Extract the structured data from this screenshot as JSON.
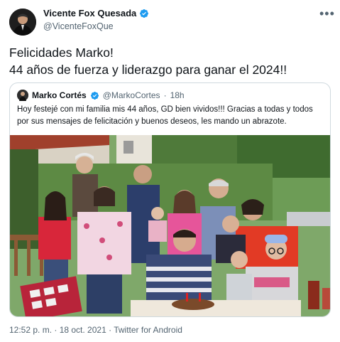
{
  "author": {
    "display_name": "Vicente Fox Quesada",
    "handle": "@VicenteFoxQue"
  },
  "tweet": {
    "line1": "Felicidades Marko!",
    "line2": "44 años de fuerza y liderazgo para ganar el 2024!!"
  },
  "quoted": {
    "display_name": "Marko Cortés",
    "handle": "@MarkoCortes",
    "separator": "·",
    "time": "18h",
    "text": "Hoy festejé con mi familia mis 44 años, GD bien vividos!!! Gracias a todas y todos por sus mensajes de felicitación y buenos deseos, les mando un abrazote."
  },
  "footer": {
    "meta": "12:52 p. m. · 18 oct. 2021 · Twitter for Android"
  },
  "colors": {
    "verified": "#1d9bf0",
    "secondary_text": "#536471",
    "border": "#cfd9de"
  },
  "icons": [
    "verified-badge-icon",
    "more-options-icon"
  ]
}
